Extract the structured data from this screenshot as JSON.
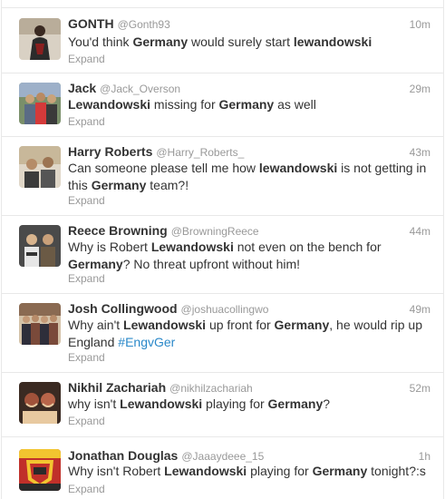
{
  "tweets": [
    {
      "name": "GONTH",
      "handle": "@Gonth93",
      "time": "10m",
      "segments": [
        {
          "text": "You'd think ",
          "style": "plain"
        },
        {
          "text": "Germany",
          "style": "bold"
        },
        {
          "text": " would surely start ",
          "style": "plain"
        },
        {
          "text": "lewandowski",
          "style": "bold"
        }
      ],
      "expand": "Expand",
      "avatar_icon": "user-photo-icon",
      "avatar_colors": [
        "#d9d1c4",
        "#2b2b2b",
        "#8a1f1f"
      ]
    },
    {
      "name": "Jack",
      "handle": "@Jack_Overson",
      "time": "29m",
      "segments": [
        {
          "text": "Lewandowski",
          "style": "bold"
        },
        {
          "text": " missing for ",
          "style": "plain"
        },
        {
          "text": "Germany",
          "style": "bold"
        },
        {
          "text": " as well",
          "style": "plain"
        }
      ],
      "expand": "Expand",
      "avatar_icon": "group-photo-icon",
      "avatar_colors": [
        "#7a8f6a",
        "#c9a37a",
        "#5a6b85"
      ]
    },
    {
      "name": "Harry Roberts",
      "handle": "@Harry_Roberts_",
      "time": "43m",
      "segments": [
        {
          "text": "Can someone please tell me how ",
          "style": "plain"
        },
        {
          "text": "lewandowski",
          "style": "bold"
        },
        {
          "text": " is not getting in this ",
          "style": "plain"
        },
        {
          "text": "Germany",
          "style": "bold"
        },
        {
          "text": " team?!",
          "style": "plain"
        }
      ],
      "expand": "Expand",
      "avatar_icon": "group-photo-icon",
      "avatar_colors": [
        "#c8b89a",
        "#3b3b3b",
        "#e0d7c8"
      ]
    },
    {
      "name": "Reece Browning",
      "handle": "@BrowningReece",
      "time": "44m",
      "segments": [
        {
          "text": "Why is Robert ",
          "style": "plain"
        },
        {
          "text": "Lewandowski",
          "style": "bold"
        },
        {
          "text": " not even on the bench for ",
          "style": "plain"
        },
        {
          "text": "Germany",
          "style": "bold"
        },
        {
          "text": "? No threat upfront without him!",
          "style": "plain"
        }
      ],
      "expand": "Expand",
      "avatar_icon": "group-photo-icon",
      "avatar_colors": [
        "#4a4a4a",
        "#e6e6e6",
        "#6b5a45"
      ]
    },
    {
      "name": "Josh Collingwood",
      "handle": "@joshuacollingwo",
      "time": "49m",
      "segments": [
        {
          "text": "Why ain't ",
          "style": "plain"
        },
        {
          "text": "Lewandowski",
          "style": "bold"
        },
        {
          "text": " up front for ",
          "style": "plain"
        },
        {
          "text": "Germany",
          "style": "bold"
        },
        {
          "text": ", he would rip up England ",
          "style": "plain"
        },
        {
          "text": "#EngvGer",
          "style": "hashtag"
        }
      ],
      "expand": "Expand",
      "avatar_icon": "group-photo-icon",
      "avatar_colors": [
        "#7a4a3a",
        "#2e2e3a",
        "#d4c2a8"
      ]
    },
    {
      "name": "Nikhil Zachariah",
      "handle": "@nikhilzachariah",
      "time": "52m",
      "segments": [
        {
          "text": "why isn't ",
          "style": "plain"
        },
        {
          "text": "Lewandowski",
          "style": "bold"
        },
        {
          "text": " playing for ",
          "style": "plain"
        },
        {
          "text": "Germany",
          "style": "bold"
        },
        {
          "text": "?",
          "style": "plain"
        }
      ],
      "expand": "Expand",
      "avatar_icon": "group-photo-icon",
      "avatar_colors": [
        "#a0523a",
        "#e8c9a0",
        "#3a2a22"
      ]
    },
    {
      "name": "Jonathan Douglas",
      "handle": "@Jaaaydeee_15",
      "time": "1h",
      "segments": [
        {
          "text": "Why isn't Robert ",
          "style": "plain"
        },
        {
          "text": "Lewandowski",
          "style": "bold"
        },
        {
          "text": " playing for ",
          "style": "plain"
        },
        {
          "text": "Germany",
          "style": "bold"
        },
        {
          "text": " tonight?:s",
          "style": "plain"
        }
      ],
      "expand": "Expand",
      "avatar_icon": "team-crest-icon",
      "avatar_colors": [
        "#c0302a",
        "#f2c530",
        "#2a2a2a"
      ]
    }
  ]
}
